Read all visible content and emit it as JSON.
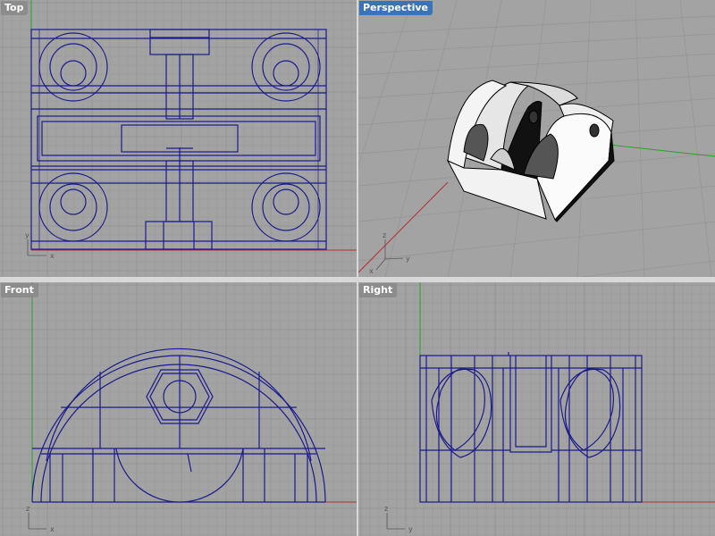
{
  "viewports": {
    "top": {
      "label": "Top",
      "active": false
    },
    "perspective": {
      "label": "Perspective",
      "active": true
    },
    "front": {
      "label": "Front",
      "active": false
    },
    "right": {
      "label": "Right",
      "active": false
    }
  },
  "axis_labels": {
    "top": [
      "y",
      "x"
    ],
    "perspective": [
      "z",
      "y",
      "x"
    ],
    "front": [
      "z",
      "x"
    ],
    "right": [
      "z",
      "y"
    ]
  },
  "colors": {
    "viewport_bg": "#a3a3a3",
    "grid_minor": "#989898",
    "grid_major": "#8a8a8a",
    "wire": "#1a1a8c",
    "x_axis": "#b03030",
    "y_axis": "#2aa02a",
    "active_label": "#3a73b8"
  }
}
